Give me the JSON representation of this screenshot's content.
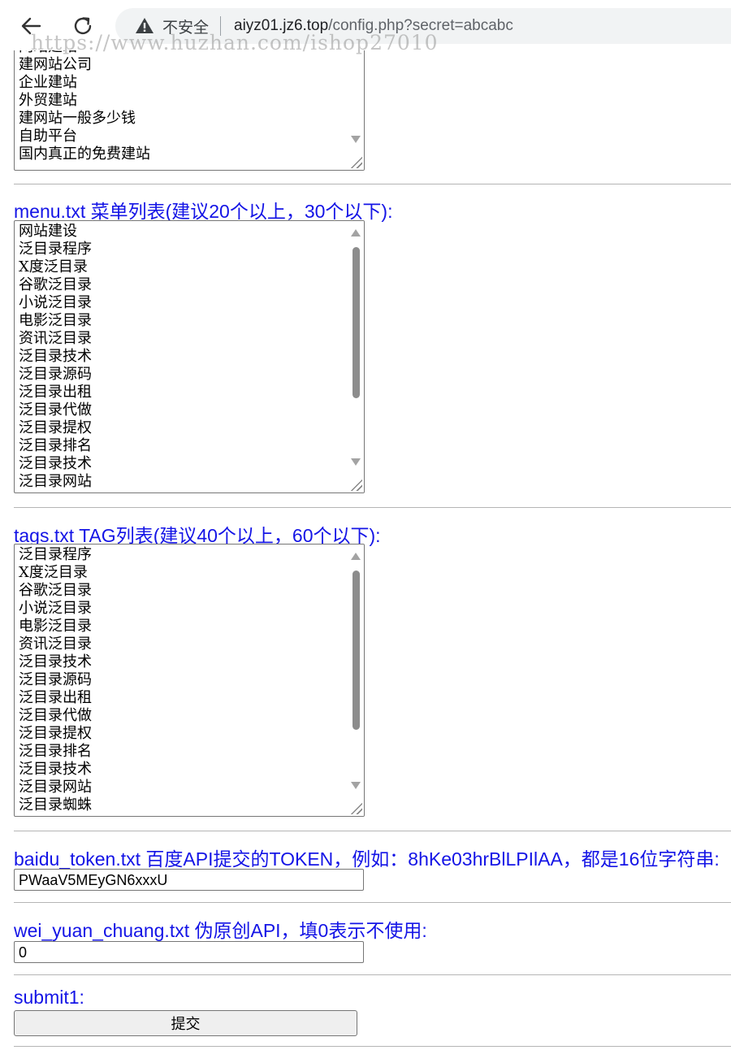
{
  "browser": {
    "not_secure_label": "不安全",
    "url_host": "aiyz01.jz6.top",
    "url_path": "/config.php?secret=abcabc",
    "watermark": "https://www.huzhan.com/ishop27010"
  },
  "first_textarea": {
    "lines": [
      "网站建站",
      "建网站公司",
      "企业建站",
      "外贸建站",
      "建网站一般多少钱",
      "自助平台",
      "国内真正的免费建站"
    ]
  },
  "menu": {
    "label": "menu.txt 菜单列表(建议20个以上，30个以下):",
    "lines": [
      "网站建设",
      "泛目录程序",
      "X度泛目录",
      "谷歌泛目录",
      "小说泛目录",
      "电影泛目录",
      "资讯泛目录",
      "泛目录技术",
      "泛目录源码",
      "泛目录出租",
      "泛目录代做",
      "泛目录提权",
      "泛目录排名",
      "泛目录技术",
      "泛目录网站"
    ]
  },
  "tags": {
    "label": "tags.txt TAG列表(建议40个以上，60个以下):",
    "lines": [
      "泛目录程序",
      "X度泛目录",
      "谷歌泛目录",
      "小说泛目录",
      "电影泛目录",
      "资讯泛目录",
      "泛目录技术",
      "泛目录源码",
      "泛目录出租",
      "泛目录代做",
      "泛目录提权",
      "泛目录排名",
      "泛目录技术",
      "泛目录网站",
      "泛目录蜘蛛"
    ]
  },
  "baidu_token": {
    "label": "baidu_token.txt 百度API提交的TOKEN，例如：8hKe03hrBlLPIlAA，都是16位字符串:",
    "value": "PWaaV5MEyGN6xxxU"
  },
  "wei_yuan_chuang": {
    "label": "wei_yuan_chuang.txt 伪原创API，填0表示不使用:",
    "value": "0"
  },
  "submit": {
    "label": "submit1:",
    "button_label": "提交"
  },
  "colors": {
    "label_color": "#1414e6",
    "border": "#767676"
  }
}
